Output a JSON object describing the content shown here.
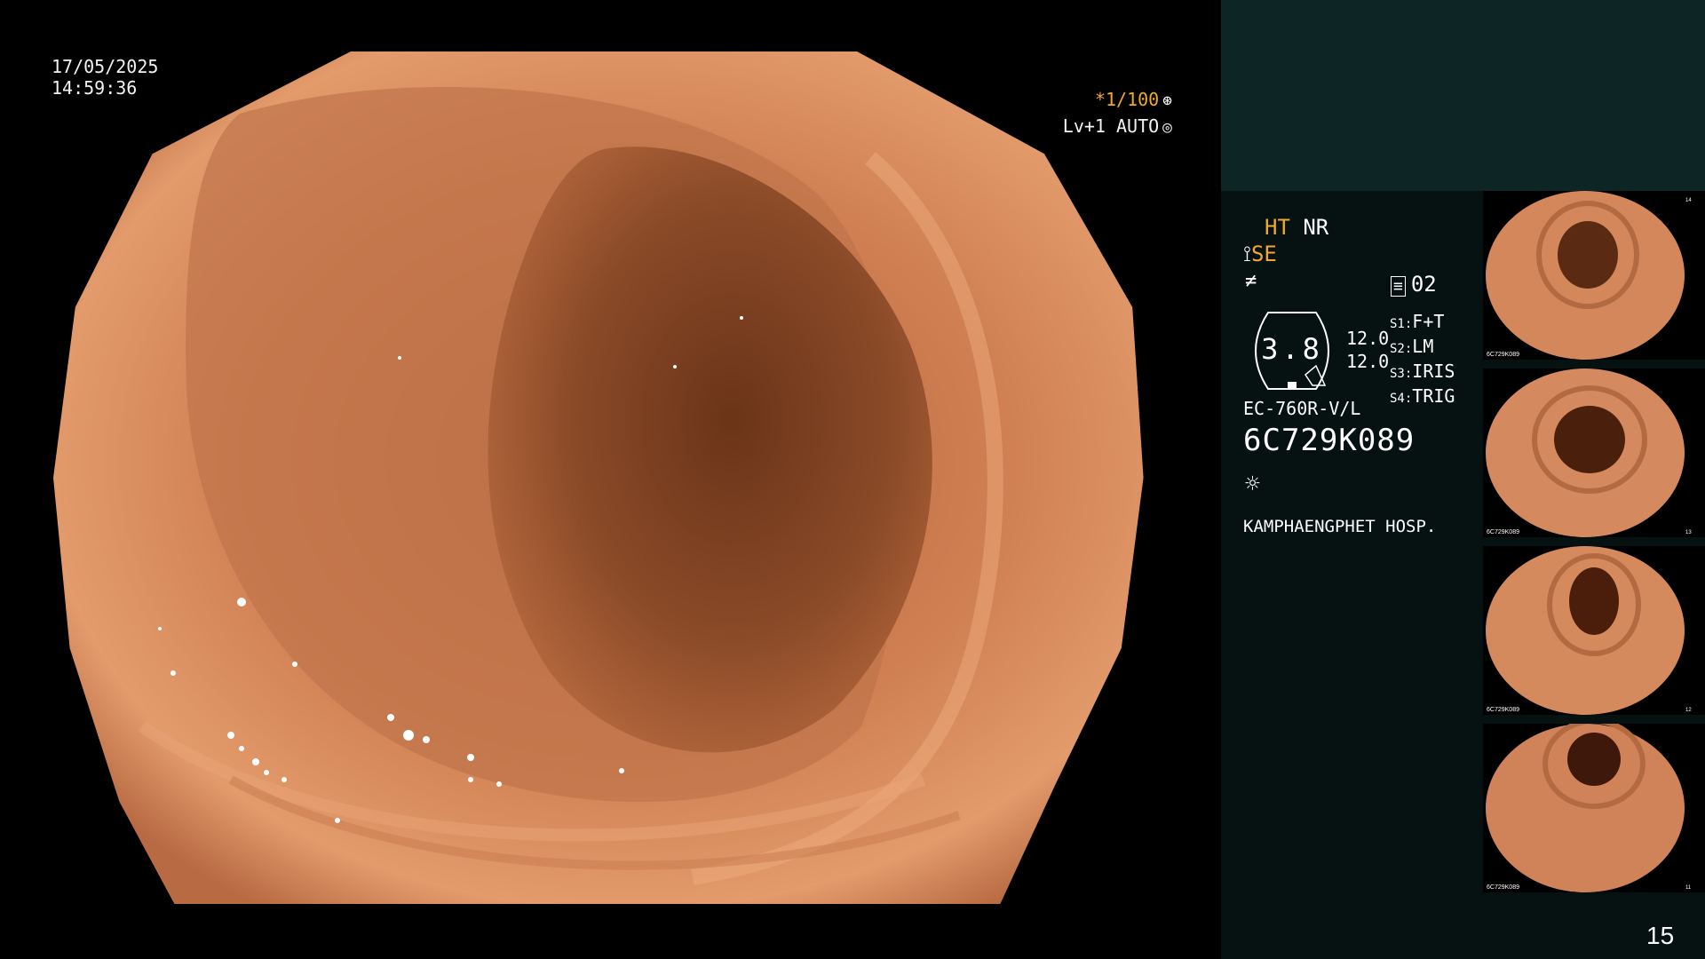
{
  "datetime": {
    "date": "17/05/2025",
    "time": "14:59:36"
  },
  "scope_status": {
    "shutter": "*1/100",
    "level": "Lv+1 AUTO",
    "shutter_icon": "aperture-icon",
    "iris_icon": "iris-icon"
  },
  "info_panel": {
    "ht": "HT",
    "nr": "NR",
    "se": "SE",
    "mode_icon": "enhancement-icon",
    "filter_icon": "slash-f-icon",
    "memo_icon": "memo-icon",
    "memo_count": "02",
    "gauge_value": "3.8",
    "values": [
      "12.0",
      "12.0"
    ],
    "switches": [
      {
        "key": "S1",
        "val": "F+T"
      },
      {
        "key": "S2",
        "val": "LM"
      },
      {
        "key": "S3",
        "val": "IRIS"
      },
      {
        "key": "S4",
        "val": "TRIG"
      }
    ],
    "scope_model": "EC-760R-V/L",
    "serial": "6C729K089",
    "light_icon": "sun-icon",
    "hospital": "KAMPHAENGPHET HOSP."
  },
  "thumbnails": [
    {
      "label": "14",
      "serial": "6C729K089"
    },
    {
      "label": "13",
      "serial": "6C729K089"
    },
    {
      "label": "12",
      "serial": "6C729K089"
    },
    {
      "label": "11",
      "serial": "6C729K089"
    }
  ],
  "page_number": "15",
  "colors": {
    "mucosa": "#d98a5e",
    "lumen": "#6b3418",
    "panel": "#061211",
    "panel_top": "#0e2526",
    "accent": "#f0a830"
  }
}
